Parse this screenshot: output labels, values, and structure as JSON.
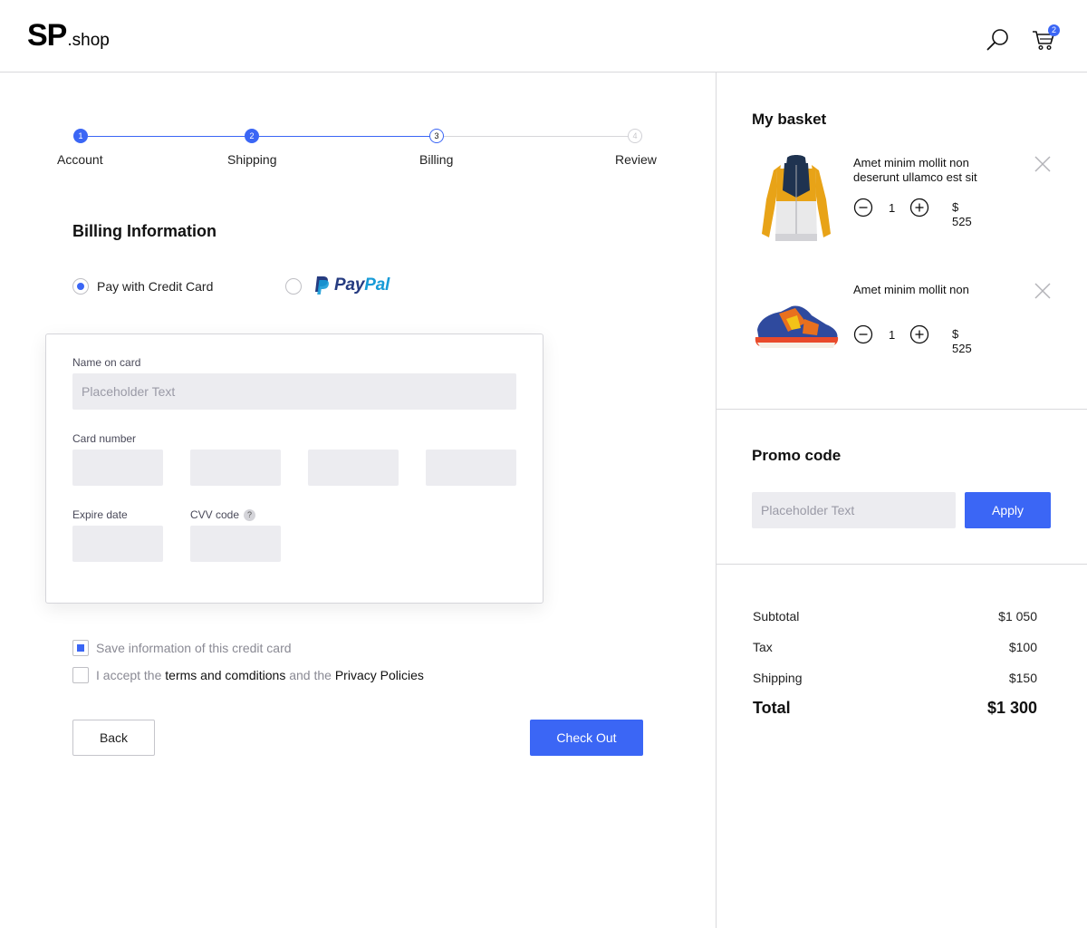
{
  "header": {
    "logo_main": "SP",
    "logo_suffix": ".shop",
    "cart_count": "2"
  },
  "stepper": {
    "steps": [
      {
        "number": "1",
        "label": "Account",
        "state": "done"
      },
      {
        "number": "2",
        "label": "Shipping",
        "state": "done"
      },
      {
        "number": "3",
        "label": "Billing",
        "state": "active"
      },
      {
        "number": "4",
        "label": "Review",
        "state": "todo"
      }
    ]
  },
  "billing": {
    "title": "Billing Information",
    "option_card": "Pay with Credit Card",
    "option_paypal_pay": "Pay",
    "option_paypal_pal": "Pal",
    "form": {
      "name_label": "Name on card",
      "name_placeholder": "Placeholder Text",
      "card_number_label": "Card number",
      "expire_label": "Expire date",
      "cvv_label": "CVV code",
      "cvv_help": "?"
    },
    "save_card_label": "Save information of this credit card",
    "terms": {
      "prefix": "I accept the ",
      "terms_link": "terms and comditions",
      "middle": " and the ",
      "privacy_link": "Privacy Policies"
    },
    "back_label": "Back",
    "checkout_label": "Check Out"
  },
  "basket": {
    "title": "My basket",
    "items": [
      {
        "name": "Amet minim mollit non deserunt ullamco est sit",
        "qty": "1",
        "currency": "$",
        "price": "525"
      },
      {
        "name": "Amet minim mollit non",
        "qty": "1",
        "currency": "$",
        "price": "525"
      }
    ]
  },
  "promo": {
    "title": "Promo code",
    "placeholder": "Placeholder Text",
    "apply_label": "Apply"
  },
  "summary": {
    "subtotal_label": "Subtotal",
    "subtotal_value": "$1 050",
    "tax_label": "Tax",
    "tax_value": "$100",
    "shipping_label": "Shipping",
    "shipping_value": "$150",
    "total_label": "Total",
    "total_value": "$1 300"
  },
  "colors": {
    "accent": "#3b66f5",
    "field_bg": "#ececf0",
    "border": "#d9d9dc"
  }
}
